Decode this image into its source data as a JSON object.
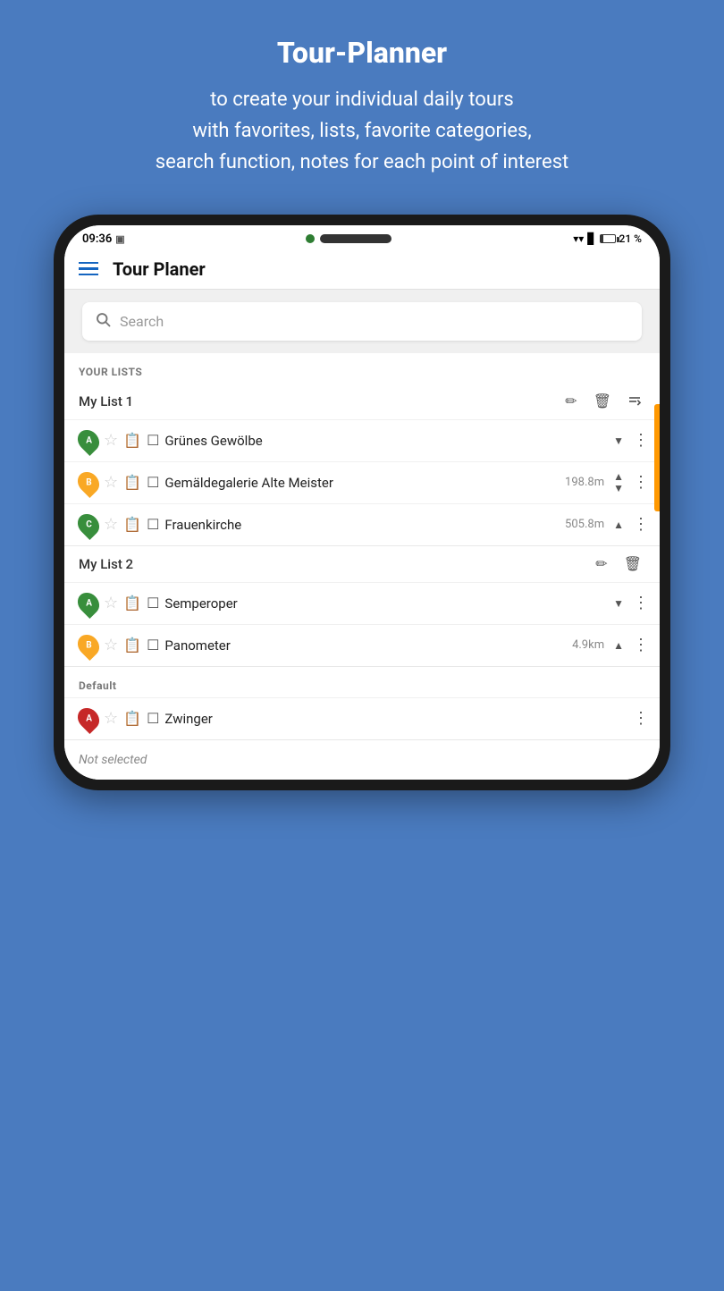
{
  "promo": {
    "title": "Tour-Planner",
    "description_line1": "to create your individual daily tours",
    "description_line2": "with favorites, lists, favorite categories,",
    "description_line3": "search function, notes for each point of interest"
  },
  "status_bar": {
    "time": "09:36",
    "battery": "21 %"
  },
  "app_bar": {
    "title": "Tour Planer"
  },
  "search": {
    "placeholder": "Search"
  },
  "section_your_lists": {
    "label": "YOUR LISTS"
  },
  "list1": {
    "name": "My List 1",
    "items": [
      {
        "id": "A",
        "pin_color": "green",
        "name": "Grünes Gewölbe",
        "distance": "",
        "has_up": false,
        "has_down": true
      },
      {
        "id": "B",
        "pin_color": "yellow",
        "name": "Gemäldegalerie Alte Meister",
        "distance": "198.8m",
        "has_up": true,
        "has_down": true
      },
      {
        "id": "C",
        "pin_color": "green",
        "name": "Frauenkirche",
        "distance": "505.8m",
        "has_up": true,
        "has_down": false
      }
    ]
  },
  "list2": {
    "name": "My List 2",
    "items": [
      {
        "id": "A",
        "pin_color": "green",
        "name": "Semperoper",
        "distance": "",
        "has_up": false,
        "has_down": true
      },
      {
        "id": "B",
        "pin_color": "yellow",
        "name": "Panometer",
        "distance": "4.9km",
        "has_up": true,
        "has_down": false
      }
    ]
  },
  "default_section": {
    "label": "Default",
    "items": [
      {
        "id": "A",
        "pin_color": "red",
        "name": "Zwinger",
        "distance": ""
      }
    ]
  },
  "not_selected": {
    "label": "Not selected"
  },
  "icons": {
    "edit": "✏",
    "delete": "🗑",
    "sort": "↕",
    "star": "☆",
    "clipboard": "📋",
    "checkbox": "☐",
    "dots": "⋮",
    "up": "▲",
    "down": "▼"
  }
}
